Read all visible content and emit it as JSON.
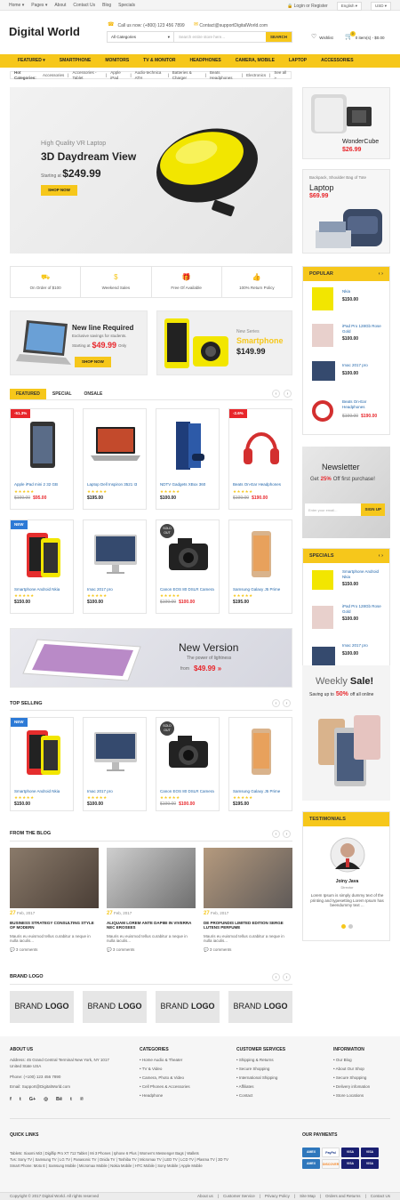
{
  "topbar": {
    "links": [
      "Home ▾",
      "Pages ▾",
      "About",
      "Contact Us",
      "Blog",
      "Specials"
    ],
    "login": "Login or Register",
    "language": "English ▾",
    "currency": "USD ▾"
  },
  "header": {
    "logo": "Digital World",
    "phone": "Call us now: (+800) 123 456 7899",
    "email": "Contact@supportDigitalWorld.com",
    "search_category": "All Categories",
    "search_placeholder": "Search entire store here...",
    "search_button": "SEARCH",
    "wishlist": "Wishlist",
    "cart_count": "0",
    "cart_text": "0 item(s) - $0.00"
  },
  "nav": [
    "FEATURED ▾",
    "SMARTPHONE",
    "MONITORS",
    "TV & MONITOR",
    "HEADPHONES",
    "CAMERA, MOBILE",
    "LAPTOP",
    "ACCESSORIES"
  ],
  "hot_categories": {
    "label": "Hot Categories:",
    "items": [
      "Accessories",
      "Accessories - Tablet",
      "Apple iPad",
      "Audio-technica ATH",
      "Batteries & Charger",
      "Beats Headphones",
      "Electronics",
      "See all »"
    ]
  },
  "hero": {
    "subtitle": "High Quality VR Laptop",
    "title": "3D Daydream View",
    "starting": "Starting at",
    "price": "$249.99",
    "button": "SHOP NOW"
  },
  "side_banners": {
    "b1_name": "WonderCube",
    "b1_price": "$26.99",
    "b2_sub": "Backpack, Shoulder Bag of Tote",
    "b2_title": "Laptop",
    "b2_price": "$69.99"
  },
  "features": [
    "On Order of $100",
    "Weekend Sales",
    "Free Of Available",
    "100% Return Policy"
  ],
  "promo1": {
    "title": "New line Required",
    "sub": "Exclusive savings for students.",
    "starting": "Starting at",
    "price": "$49.99",
    "only": "Only",
    "button": "SHOP NOW"
  },
  "promo2": {
    "sub": "New Series",
    "title": "Smartphone",
    "price": "$149.99"
  },
  "tabs": [
    "FEATURED",
    "SPECIAL",
    "ONSALE"
  ],
  "products_row1": [
    {
      "title": "Apple iPad mini 2 32 GB",
      "stars": "★★★★★",
      "old": "$199.00",
      "price": "$95.00",
      "badge": "-51.3%"
    },
    {
      "title": "Laptop Dell Inspiron 3521 I3",
      "stars": "★★★★★",
      "old": "",
      "price": "$195.00",
      "badge": ""
    },
    {
      "title": "NDTV Gadgets XBox 360",
      "stars": "★★★★★",
      "old": "",
      "price": "$100.00",
      "badge": ""
    },
    {
      "title": "Beats On-Ear Headphones",
      "stars": "★★★★★",
      "old": "$199.00",
      "price": "$190.00",
      "badge": "-2.6%"
    }
  ],
  "products_row2": [
    {
      "title": "Smartphone Android Nkia",
      "stars": "★★★★★",
      "old": "",
      "price": "$150.00",
      "badge": "NEW"
    },
    {
      "title": "Imac 2017 pro",
      "stars": "★★★★★",
      "old": "",
      "price": "$100.00",
      "badge": ""
    },
    {
      "title": "Canon EOS 80 DSLR Camera",
      "stars": "★★★★★",
      "old": "$199.00",
      "price": "$100.00",
      "badge": "SOLD OUT"
    },
    {
      "title": "Samsung Galaxy J5 Prime",
      "stars": "★★★★★",
      "old": "",
      "price": "$195.00",
      "badge": ""
    }
  ],
  "wide_banner": {
    "title": "New Version",
    "sub": "The power of lightness",
    "from": "from",
    "price": "$49.99 »"
  },
  "top_selling": {
    "title": "TOP SELLING",
    "items": [
      {
        "title": "Smartphone Android Nkia",
        "stars": "★★★★★",
        "old": "",
        "price": "$150.00",
        "badge": "NEW"
      },
      {
        "title": "Imac 2017 pro",
        "stars": "★★★★★",
        "old": "",
        "price": "$100.00",
        "badge": ""
      },
      {
        "title": "Canon EOS 80 DSLR Camera",
        "stars": "★★★★★",
        "old": "$199.00",
        "price": "$100.00",
        "badge": "SOLD OUT"
      },
      {
        "title": "Samsung Galaxy J5 Prime",
        "stars": "★★★★★",
        "old": "",
        "price": "$195.00",
        "badge": ""
      }
    ]
  },
  "blog": {
    "title": "FROM THE BLOG",
    "posts": [
      {
        "day": "27",
        "month": "Feb, 2017",
        "title": "BUSINESS STRATEGY CONSULTING STYLE OF MODERN",
        "text": "Mauris eu euismod tellus curabitur a neque in nulla iaculis...",
        "comments": "3 comments"
      },
      {
        "day": "27",
        "month": "Feb, 2017",
        "title": "ALIQUAM LOREM ANTE DAPIBI IN VIVERRA NEC EROSEES",
        "text": "Mauris eu euismod tellus curabitur a neque in nulla iaculis...",
        "comments": "3 comments"
      },
      {
        "day": "27",
        "month": "Feb, 2017",
        "title": "DE PROFUNDIS LIMITED EDITION SERGE LUTENS PERFUME",
        "text": "Mauris eu euismod tellus curabitur a neque in nulla iaculis...",
        "comments": "3 comments"
      }
    ]
  },
  "brand": {
    "title": "BRAND LOGO",
    "items": [
      [
        "BRAND",
        "LOGO"
      ],
      [
        "BRAND",
        "LOGO"
      ],
      [
        "BRAND",
        "LOGO"
      ],
      [
        "BRAND",
        "LOGO"
      ]
    ]
  },
  "popular": {
    "title": "POPULAR",
    "items": [
      {
        "title": "Nkia",
        "price": "$150.00",
        "old": ""
      },
      {
        "title": "iPad Pro 128Gb Rose Gold",
        "price": "$100.00",
        "old": ""
      },
      {
        "title": "Imac 2017 pro",
        "price": "$100.00",
        "old": ""
      },
      {
        "title": "Beats On-Ear Headphones",
        "price": "$190.00",
        "old": "$199.00"
      }
    ]
  },
  "newsletter": {
    "title": "Newsletter",
    "get": "Get",
    "pct": "25%",
    "rest": "Off first purchase!",
    "placeholder": "Enter your email...",
    "button": "SIGN UP"
  },
  "specials": {
    "title": "SPECIALS",
    "items": [
      {
        "title": "Smartphone Android Nkia",
        "price": "$150.00"
      },
      {
        "title": "iPad Pro 128Gb Rose Gold",
        "price": "$100.00"
      },
      {
        "title": "Imac 2017 pro",
        "price": "$100.00"
      }
    ]
  },
  "weekly": {
    "title": "Weekly",
    "sale": "Sale!",
    "saving": "Saving up to",
    "pct": "50%",
    "rest": "off all online"
  },
  "testimonials": {
    "title": "TESTIMONIALS",
    "name": "Joiny Java",
    "role": "Director",
    "text": "Lorem Ipsum is simply dummy text of the printing and typesetting Lorem Ipsum has beendummy text ..."
  },
  "footer": {
    "about_title": "ABOUT US",
    "address": "Address: 45 Grand Central Terminal New York, NY 1017 United State USA",
    "phone": "Phone: (+100) 123 456 7890",
    "email": "Email: Support@DigitalWorld.com",
    "social": [
      "f",
      "t",
      "G+",
      "◎",
      "Bē",
      "t",
      "℗"
    ],
    "categories_title": "CATEGORIES",
    "categories": [
      "Home Audio & Theater",
      "TV & Video",
      "Camera, Photo & Video",
      "Cell Phones & Accessories",
      "Headphone"
    ],
    "service_title": "CUSTOMER SERVICES",
    "service": [
      "Shipping & Returns",
      "Secure Shopping",
      "International Shipping",
      "Affiliates",
      "Contact"
    ],
    "info_title": "INFORMATION",
    "info": [
      "Our Blog",
      "About Our Shop",
      "Secure Shopping",
      "Delivery infomation",
      "Store Locations"
    ],
    "quick_title": "QUICK LINKS",
    "quick_lines": [
      "Tablets: Xiaomi Mi3 | Digiflip Pro XT 712 Tablet | Mi 3 Phones | Iphone 6 Plus | Women's Messenger Bags | Wallets",
      "Tvs: Sony TV | Samsung TV | LG TV | Panasonic TV | Onida TV | Toshiba TV | Micromax TV | LED TV | LCD TV | Plasma TV | 3D TV",
      "Smart Phone: Moto E | Samsung Mobile | Micromax Mobile | Nokia Mobile | HTC Mobile | Sony Mobile | Apple Mobile"
    ],
    "payments_title": "OUR PAYMENTS",
    "payments": [
      "AMEX",
      "PayPal",
      "VISA",
      "VISA",
      "AMEX",
      "DISCOVER",
      "VISA",
      "VISA"
    ],
    "copyright": "Copyright © 2017 Digital World. All rights reserved",
    "bottom_links": [
      "About us",
      "Customer Service",
      "Privacy Policy",
      "Site Map",
      "Orders and Returns",
      "Contact Us"
    ]
  },
  "colors": {
    "accent": "#f6c71b",
    "sale": "#e8262b",
    "link": "#2266aa"
  }
}
